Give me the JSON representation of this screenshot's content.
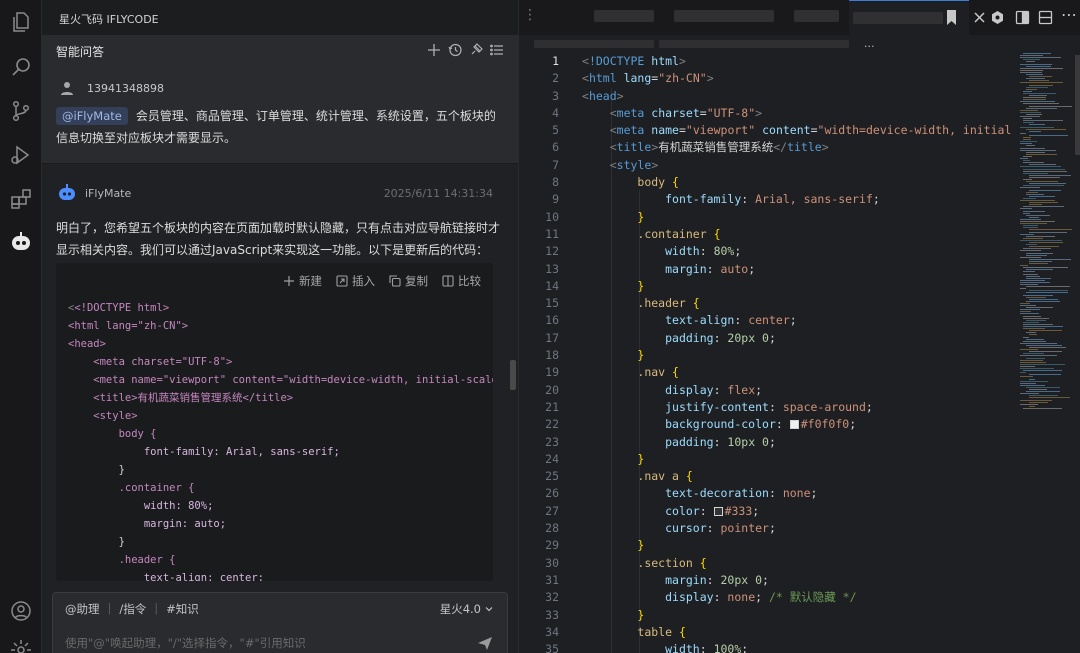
{
  "activity_bar": {
    "items": [
      "explorer-icon",
      "search-icon",
      "source-control-icon",
      "run-debug-icon",
      "extensions-icon",
      "iflycode-icon",
      "account-icon",
      "settings-icon"
    ]
  },
  "chat": {
    "window_title": "星火飞码 IFLYCODE",
    "panel_title": "智能问答",
    "user": {
      "name": "13941348898",
      "tag": "@iFlyMate",
      "message": "会员管理、商品管理、订单管理、统计管理、系统设置，五个板块的信息切换至对应板块才需要显示。"
    },
    "bot": {
      "name": "iFlyMate",
      "time": "2025/6/11 14:31:34",
      "message": "明白了，您希望五个板块的内容在页面加载时默认隐藏，只有点击对应导航链接时才显示相关内容。我们可以通过JavaScript来实现这一功能。以下是更新后的代码：",
      "code_actions": [
        "新建",
        "插入",
        "复制",
        "比较"
      ],
      "code_lines": [
        "<!DOCTYPE html>",
        "<html lang=\"zh-CN\">",
        "<head>",
        "    <meta charset=\"UTF-8\">",
        "    <meta name=\"viewport\" content=\"width=device-width, initial-scale=",
        "    <title>有机蔬菜销售管理系统</title>",
        "    <style>",
        "        body {",
        "            font-family: Arial, sans-serif;",
        "        }",
        "        .container {",
        "            width: 80%;",
        "            margin: auto;",
        "        }",
        "        .header {",
        "            text-align: center;"
      ]
    },
    "input": {
      "options": [
        "@助理",
        "/指令",
        "#知识"
      ],
      "model": "星火4.0",
      "placeholder": "使用\"@\"唤起助理，\"/\"选择指令，\"#\"引用知识"
    }
  },
  "editor": {
    "breadcrumb_more": "...",
    "current_line": 1,
    "line_numbers": [
      "1",
      "2",
      "3",
      "4",
      "5",
      "6",
      "7",
      "8",
      "9",
      "10",
      "11",
      "12",
      "13",
      "14",
      "15",
      "16",
      "17",
      "18",
      "19",
      "20",
      "21",
      "22",
      "23",
      "24",
      "25",
      "26",
      "27",
      "28",
      "29",
      "30",
      "31",
      "32",
      "33",
      "34",
      "35"
    ],
    "lines": [
      "<!DOCTYPE html>",
      "<html lang=\"zh-CN\">",
      "<head>",
      "    <meta charset=\"UTF-8\">",
      "    <meta name=\"viewport\" content=\"width=device-width, initial",
      "    <title>有机蔬菜销售管理系统</title>",
      "    <style>",
      "        body {",
      "            font-family: Arial, sans-serif;",
      "        }",
      "        .container {",
      "            width: 80%;",
      "            margin: auto;",
      "        }",
      "        .header {",
      "            text-align: center;",
      "            padding: 20px 0;",
      "        }",
      "        .nav {",
      "            display: flex;",
      "            justify-content: space-around;",
      "            background-color: #f0f0f0;",
      "            padding: 10px 0;",
      "        }",
      "        .nav a {",
      "            text-decoration: none;",
      "            color: #333;",
      "            cursor: pointer;",
      "        }",
      "        .section {",
      "            margin: 20px 0;",
      "            display: none; /* 默认隐藏 */",
      "        }",
      "        table {",
      "            width: 100%;"
    ],
    "colors": {
      "swatch_1": "#f0f0f0",
      "swatch_2": "#333333",
      "accent": "#3a7bd5"
    }
  }
}
